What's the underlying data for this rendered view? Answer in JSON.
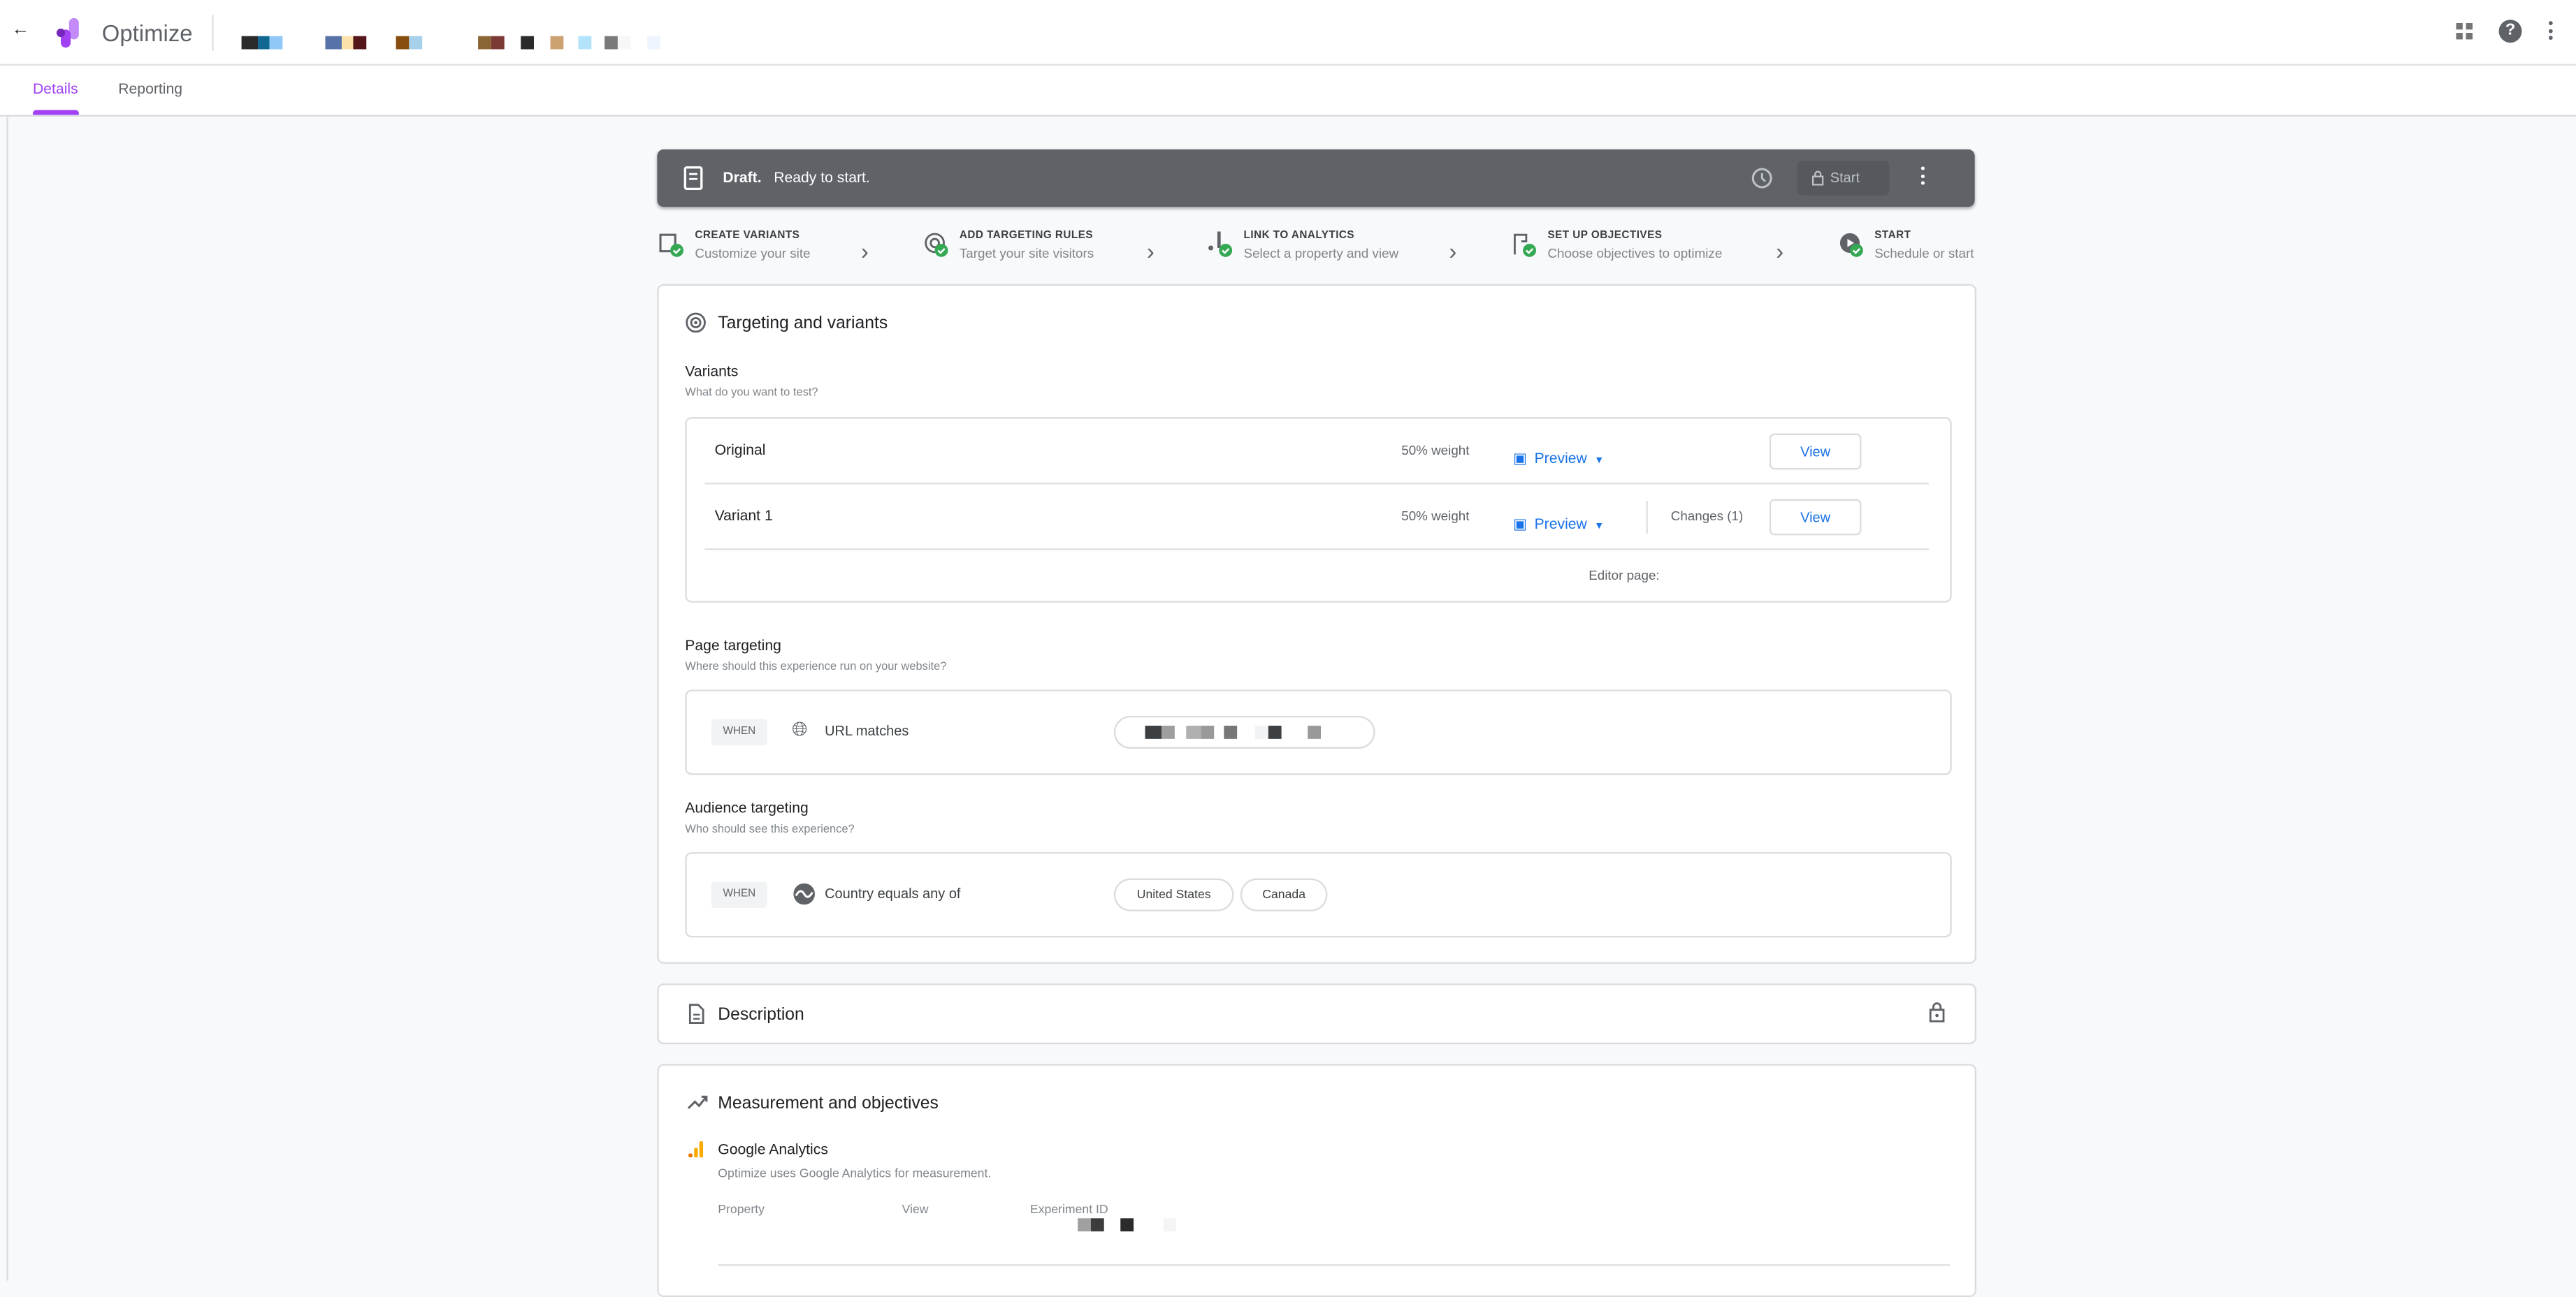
{
  "app": {
    "title": "Optimize"
  },
  "tabs": [
    {
      "label": "Details",
      "active": true
    },
    {
      "label": "Reporting",
      "active": false
    }
  ],
  "status_bar": {
    "state": "Draft.",
    "message": "Ready to start.",
    "start_label": "Start"
  },
  "steps": [
    {
      "title": "CREATE VARIANTS",
      "subtitle": "Customize your site"
    },
    {
      "title": "ADD TARGETING RULES",
      "subtitle": "Target your site visitors"
    },
    {
      "title": "LINK TO ANALYTICS",
      "subtitle": "Select a property and view"
    },
    {
      "title": "SET UP OBJECTIVES",
      "subtitle": "Choose objectives to optimize"
    },
    {
      "title": "START",
      "subtitle": "Schedule or start"
    }
  ],
  "targeting": {
    "title": "Targeting and variants",
    "variants_label": "Variants",
    "variants_sub": "What do you want to test?",
    "variants": [
      {
        "name": "Original",
        "weight": "50% weight",
        "preview": "Preview",
        "view": "View"
      },
      {
        "name": "Variant 1",
        "weight": "50% weight",
        "preview": "Preview",
        "changes": "Changes (1)",
        "view": "View"
      }
    ],
    "editor_page": "Editor page:",
    "page_label": "Page targeting",
    "page_sub": "Where should this experience run on your website?",
    "page_when": "WHEN",
    "page_rule": "URL matches",
    "audience_label": "Audience targeting",
    "audience_sub": "Who should see this experience?",
    "audience_when": "WHEN",
    "audience_rule": "Country equals any of",
    "countries": [
      "United States",
      "Canada"
    ]
  },
  "description": {
    "title": "Description"
  },
  "measurement": {
    "title": "Measurement and objectives",
    "ga_title": "Google Analytics",
    "ga_sub": "Optimize uses Google Analytics for measurement.",
    "columns": [
      "Property",
      "View",
      "Experiment ID"
    ]
  },
  "colors": {
    "accent": "#a142f4",
    "link": "#1a73e8",
    "bar": "#5f6368",
    "check": "#34a853"
  }
}
